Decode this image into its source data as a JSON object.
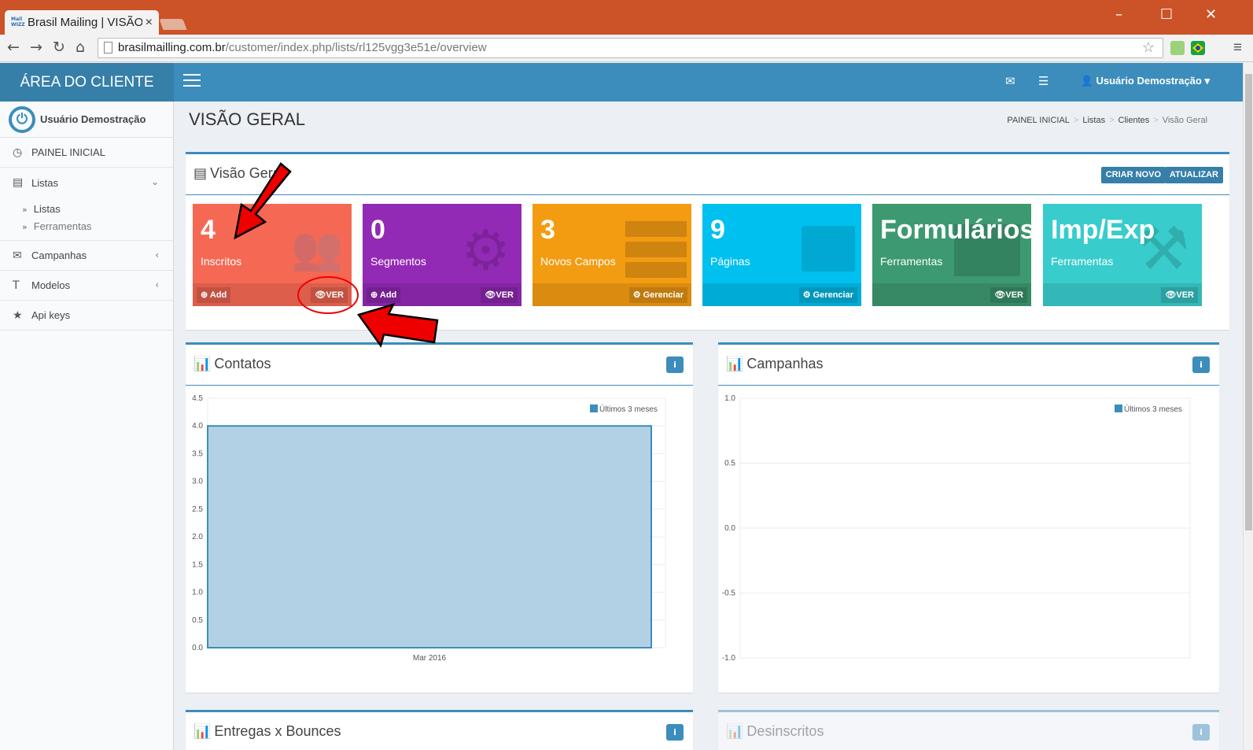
{
  "browser": {
    "tab_title": "Brasil Mailing | VISÃO",
    "favicon_text": "Mail WIZZ",
    "url_host": "brasilmailling.com.br",
    "url_path": "/customer/index.php/lists/rl125vgg3e51e/overview"
  },
  "header": {
    "logo_text": "ÁREA DO CLIENTE",
    "user_menu": "Usuário Demostração"
  },
  "sidebar": {
    "user_name": "Usuário Demostração",
    "items": [
      {
        "label": "PAINEL INICIAL"
      },
      {
        "label": "Listas"
      },
      {
        "label": "Campanhas"
      },
      {
        "label": "Modelos"
      },
      {
        "label": "Api keys"
      }
    ],
    "sub_items": [
      {
        "label": "Listas"
      },
      {
        "label": "Ferramentas"
      }
    ]
  },
  "page": {
    "title": "VISÃO GERAL",
    "breadcrumb": [
      "PAINEL INICIAL",
      "Listas",
      "Clientes",
      "Visão Geral"
    ]
  },
  "overview": {
    "title": "Visão Geral",
    "btn_create": "CRIAR NOVO",
    "btn_update": "ATUALIZAR",
    "tiles": [
      {
        "value": "4",
        "label": "Inscritos",
        "left_btn": "Add",
        "right_btn": "VER",
        "color": "#f56954"
      },
      {
        "value": "0",
        "label": "Segmentos",
        "left_btn": "Add",
        "right_btn": "VER",
        "color": "#932ab6"
      },
      {
        "value": "3",
        "label": "Novos Campos",
        "right_btn": "Gerenciar",
        "color": "#f39c12"
      },
      {
        "value": "9",
        "label": "Páginas",
        "right_btn": "Gerenciar",
        "color": "#00c0ef"
      },
      {
        "value": "Formulários",
        "label": "Ferramentas",
        "right_btn": "VER",
        "color": "#3d9970"
      },
      {
        "value": "Imp/Exp",
        "label": "Ferramentas",
        "right_btn": "VER",
        "color": "#39cccc"
      }
    ]
  },
  "panels": {
    "contatos": "Contatos",
    "campanhas": "Campanhas",
    "entregas": "Entregas x Bounces",
    "desinscritos": "Desinscritos"
  },
  "chart_data": [
    {
      "type": "area",
      "title": "Contatos",
      "categories": [
        "Mar 2016"
      ],
      "series": [
        {
          "name": "Últimos 3 meses",
          "values": [
            4
          ]
        }
      ],
      "ylim": [
        0,
        4.5
      ],
      "yticks": [
        "4.5",
        "4.0",
        "3.5",
        "3.0",
        "2.5",
        "2.0",
        "1.5",
        "1.0",
        "0.5",
        "0.0"
      ],
      "legend": "top-right",
      "grid": true,
      "color": "#3c8dbc"
    },
    {
      "type": "line",
      "title": "Campanhas",
      "categories": [],
      "series": [
        {
          "name": "Últimos 3 meses",
          "values": []
        }
      ],
      "ylim": [
        -1,
        1
      ],
      "yticks": [
        "1.0",
        "0.5",
        "0.0",
        "-0.5",
        "-1.0"
      ],
      "legend": "top-right",
      "grid": true,
      "color": "#3c8dbc"
    }
  ]
}
